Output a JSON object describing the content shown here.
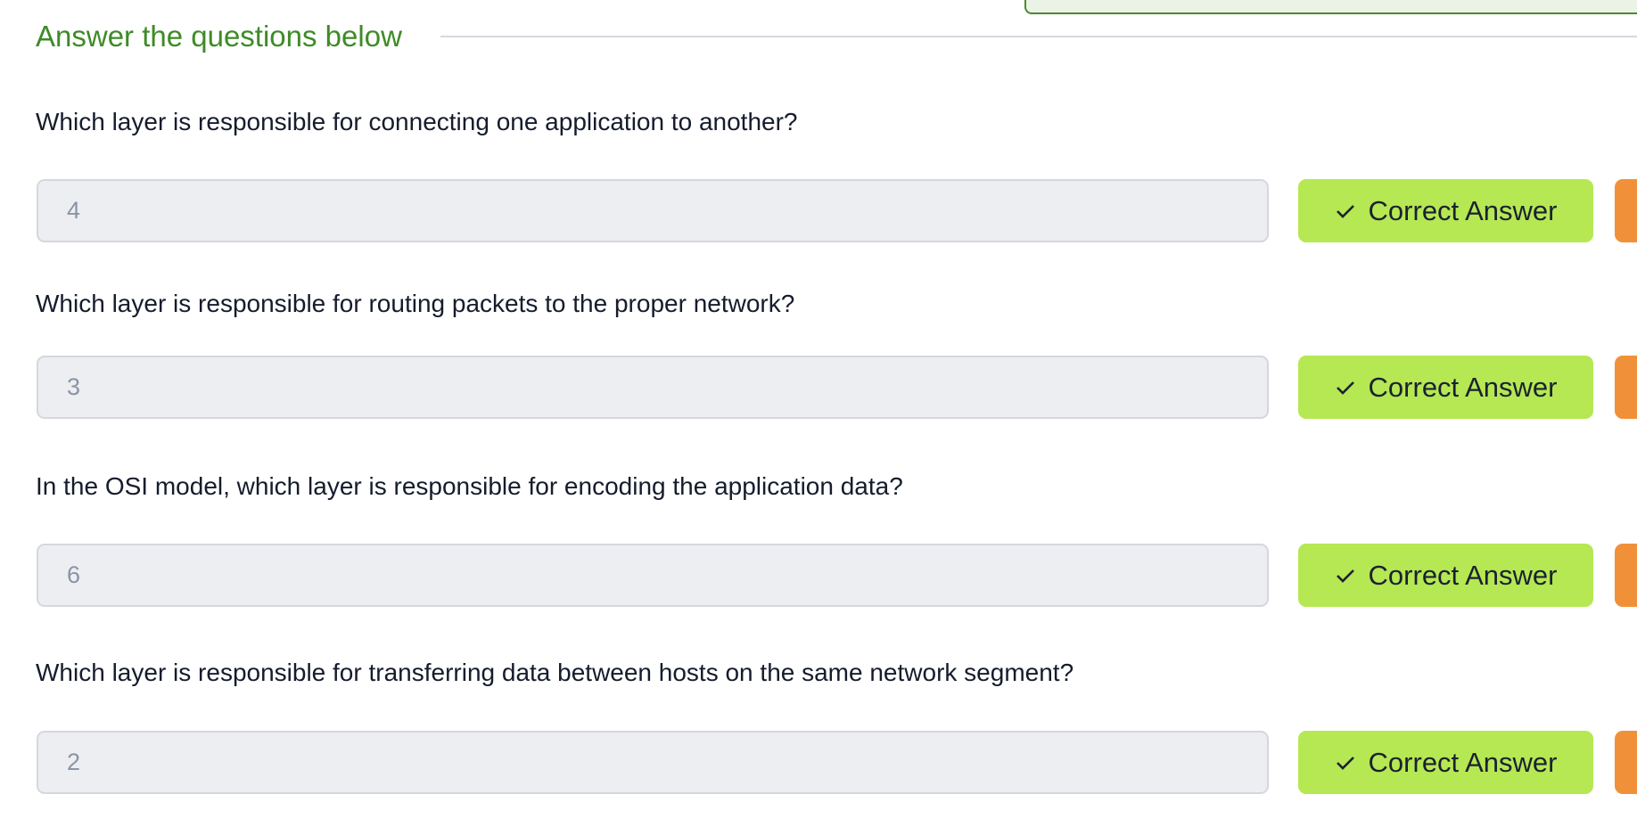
{
  "section_title": "Answer the questions below",
  "questions": [
    {
      "text": "Which layer is responsible for connecting one application to another?",
      "answer": "4",
      "button": "Correct Answer"
    },
    {
      "text": "Which layer is responsible for routing packets to the proper network?",
      "answer": "3",
      "button": "Correct Answer"
    },
    {
      "text": "In the OSI model, which layer is responsible for encoding the application data?",
      "answer": "6",
      "button": "Correct Answer"
    },
    {
      "text": "Which layer is responsible for transferring data between hosts on the same network segment?",
      "answer": "2",
      "button": "Correct Answer"
    }
  ],
  "icons": {
    "check": "check-icon"
  },
  "colors": {
    "accent_green": "#3e8b26",
    "button_green": "#b5e853",
    "hint_orange": "#f0913a"
  }
}
